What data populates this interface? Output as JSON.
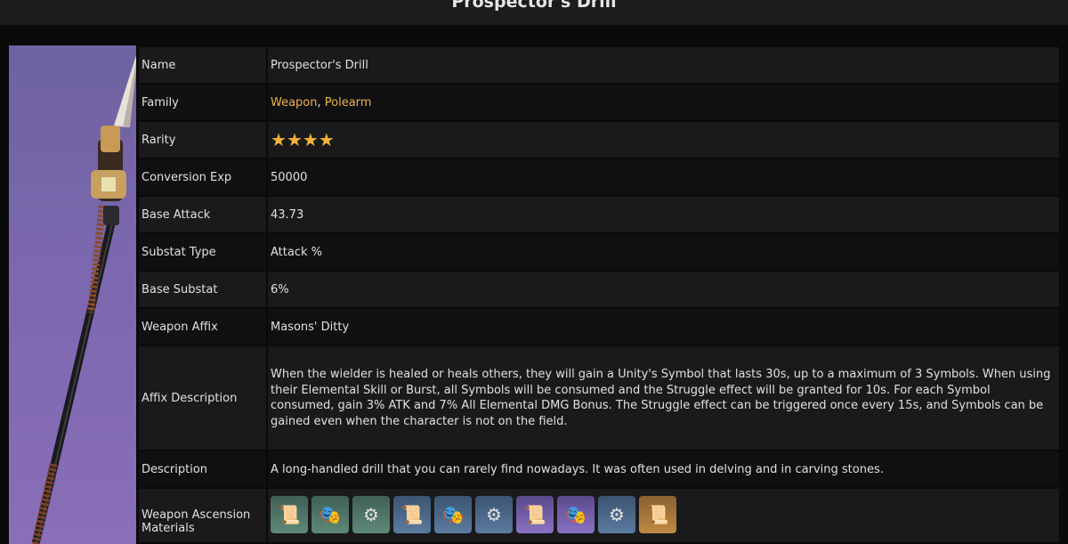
{
  "page": {
    "title": "Prospector's Drill"
  },
  "table": {
    "rows": [
      {
        "label": "Name",
        "value": "Prospector's Drill"
      },
      {
        "label": "Family",
        "value_links": [
          "Weapon",
          "Polearm"
        ],
        "separator": ", "
      },
      {
        "label": "Rarity",
        "stars": 4
      },
      {
        "label": "Conversion Exp",
        "value": "50000"
      },
      {
        "label": "Base Attack",
        "value": "43.73"
      },
      {
        "label": "Substat Type",
        "value": "Attack %"
      },
      {
        "label": "Base Substat",
        "value": "6%"
      },
      {
        "label": "Weapon Affix",
        "value": "Masons' Ditty"
      },
      {
        "label": "Affix Description",
        "value": "When the wielder is healed or heals others, they will gain a Unity's Symbol that lasts 30s, up to a maximum of 3 Symbols. When using their Elemental Skill or Burst, all Symbols will be consumed and the Struggle effect will be granted for 10s. For each Symbol consumed, gain 3% ATK and 7% All Elemental DMG Bonus. The Struggle effect can be triggered once every 15s, and Symbols can be gained even when the character is not on the field."
      },
      {
        "label": "Description",
        "value": "A long-handled drill that you can rarely find nowadays. It was often used in delving and in carving stones."
      },
      {
        "label": "Weapon Ascension Materials"
      }
    ],
    "materials": [
      {
        "icon": "scroll-icon",
        "glyph": "📜",
        "color": "green"
      },
      {
        "icon": "mask-icon",
        "glyph": "🎭",
        "color": "green"
      },
      {
        "icon": "gear-icon",
        "glyph": "⚙",
        "color": "green"
      },
      {
        "icon": "scroll-icon",
        "glyph": "📜",
        "color": "blue"
      },
      {
        "icon": "mask-icon",
        "glyph": "🎭",
        "color": "blue"
      },
      {
        "icon": "gear-icon",
        "glyph": "⚙",
        "color": "blue"
      },
      {
        "icon": "scroll-icon",
        "glyph": "📜",
        "color": "purple"
      },
      {
        "icon": "mask-icon",
        "glyph": "🎭",
        "color": "purple"
      },
      {
        "icon": "gear-icon",
        "glyph": "⚙",
        "color": "blue"
      },
      {
        "icon": "scroll-icon",
        "glyph": "📜",
        "color": "gold"
      }
    ]
  }
}
